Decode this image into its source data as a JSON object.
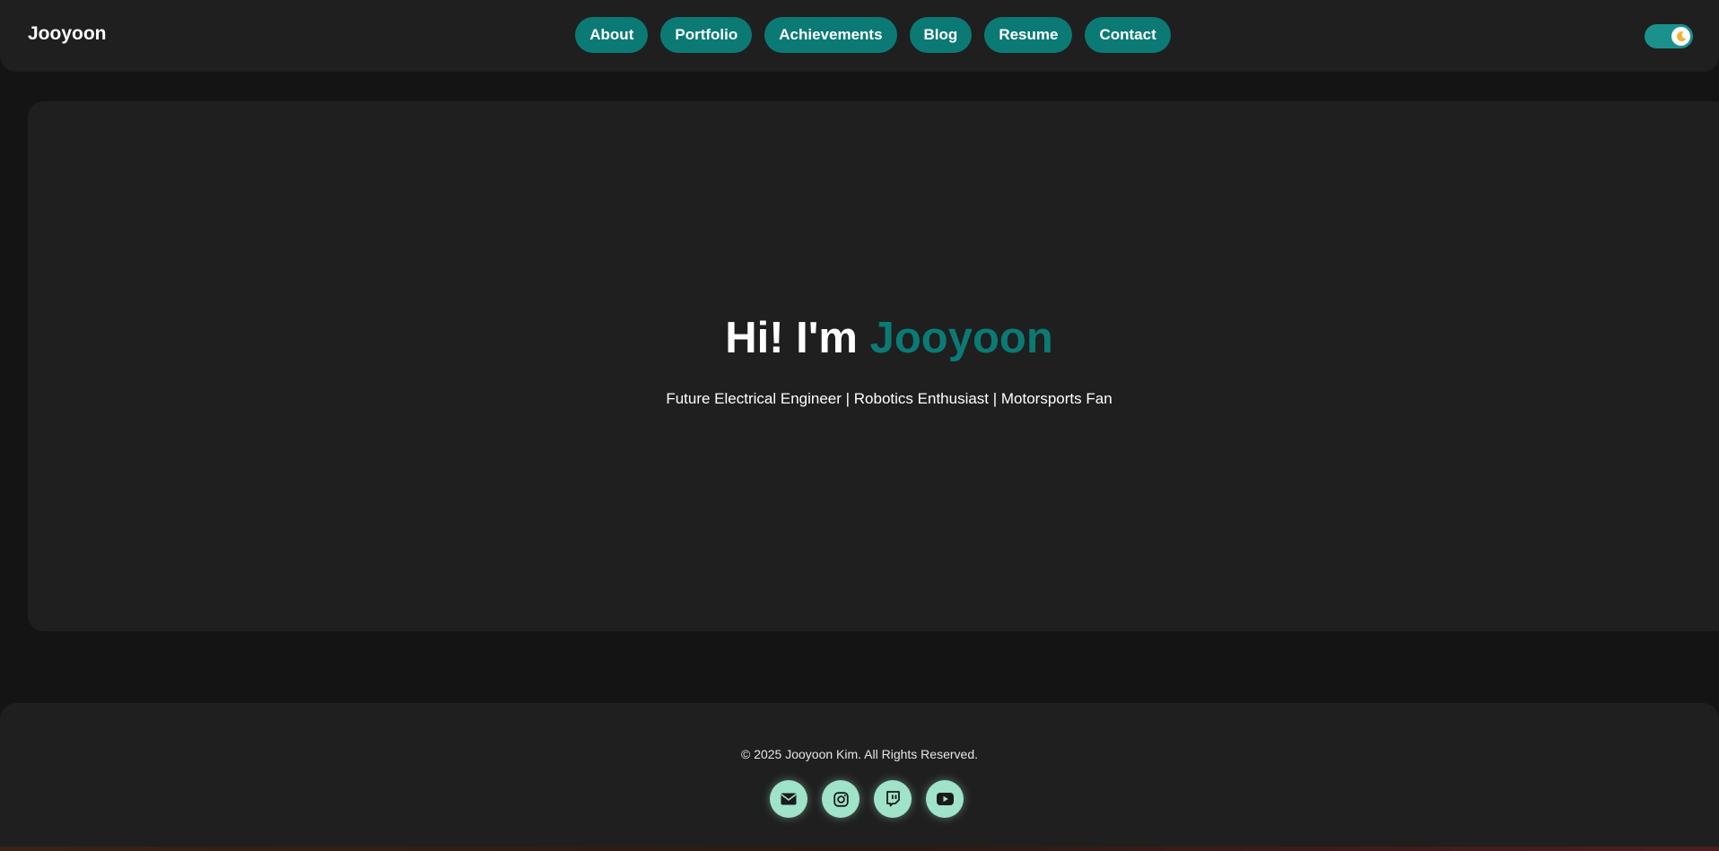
{
  "nav": {
    "brand": "Jooyoon",
    "links": [
      "About",
      "Portfolio",
      "Achievements",
      "Blog",
      "Resume",
      "Contact"
    ],
    "theme_toggle_icon": "moon-icon"
  },
  "hero": {
    "greeting": "Hi! I'm",
    "name": "Jooyoon",
    "subtitle": "Future Electrical Engineer | Robotics Enthusiast | Motorsports Fan"
  },
  "footer": {
    "copyright": "© 2025 Jooyoon Kim. All Rights Reserved.",
    "social_icons": [
      "envelope-icon",
      "instagram-icon",
      "twitch-icon",
      "youtube-icon"
    ]
  },
  "colors": {
    "accent": "#0b7a75",
    "background": "#141414",
    "surface": "#1f1f1f",
    "social_bg": "#9fe3c9"
  }
}
